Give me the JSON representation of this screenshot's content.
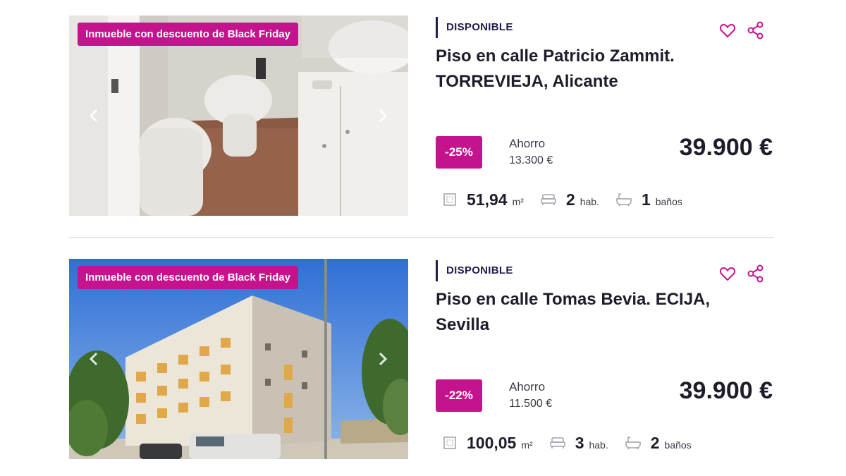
{
  "listings": [
    {
      "promo": "Inmueble con descuento de Black Friday",
      "status": "DISPONIBLE",
      "title": "Piso en calle Patricio Zammit. TORREVIEJA, Alicante",
      "discount": "-25%",
      "savings_label": "Ahorro",
      "savings_value": "13.300 €",
      "price": "39.900 €",
      "area_value": "51,94",
      "area_unit": "m²",
      "rooms_value": "2",
      "rooms_unit": "hab.",
      "baths_value": "1",
      "baths_unit": "baños"
    },
    {
      "promo": "Inmueble con descuento de Black Friday",
      "status": "DISPONIBLE",
      "title": "Piso en calle Tomas Bevia. ECIJA, Sevilla",
      "discount": "-22%",
      "savings_label": "Ahorro",
      "savings_value": "11.500 €",
      "price": "39.900 €",
      "area_value": "100,05",
      "area_unit": "m²",
      "rooms_value": "3",
      "rooms_unit": "hab.",
      "baths_value": "2",
      "baths_unit": "baños"
    }
  ],
  "colors": {
    "accent": "#c5128d",
    "status_bar": "#1d1d4f",
    "text": "#1d1d2b",
    "divider": "#d9d9e3"
  },
  "icons": [
    "chevron-left-icon",
    "chevron-right-icon",
    "heart-icon",
    "share-icon",
    "area-icon",
    "bed-icon",
    "bathtub-icon"
  ]
}
